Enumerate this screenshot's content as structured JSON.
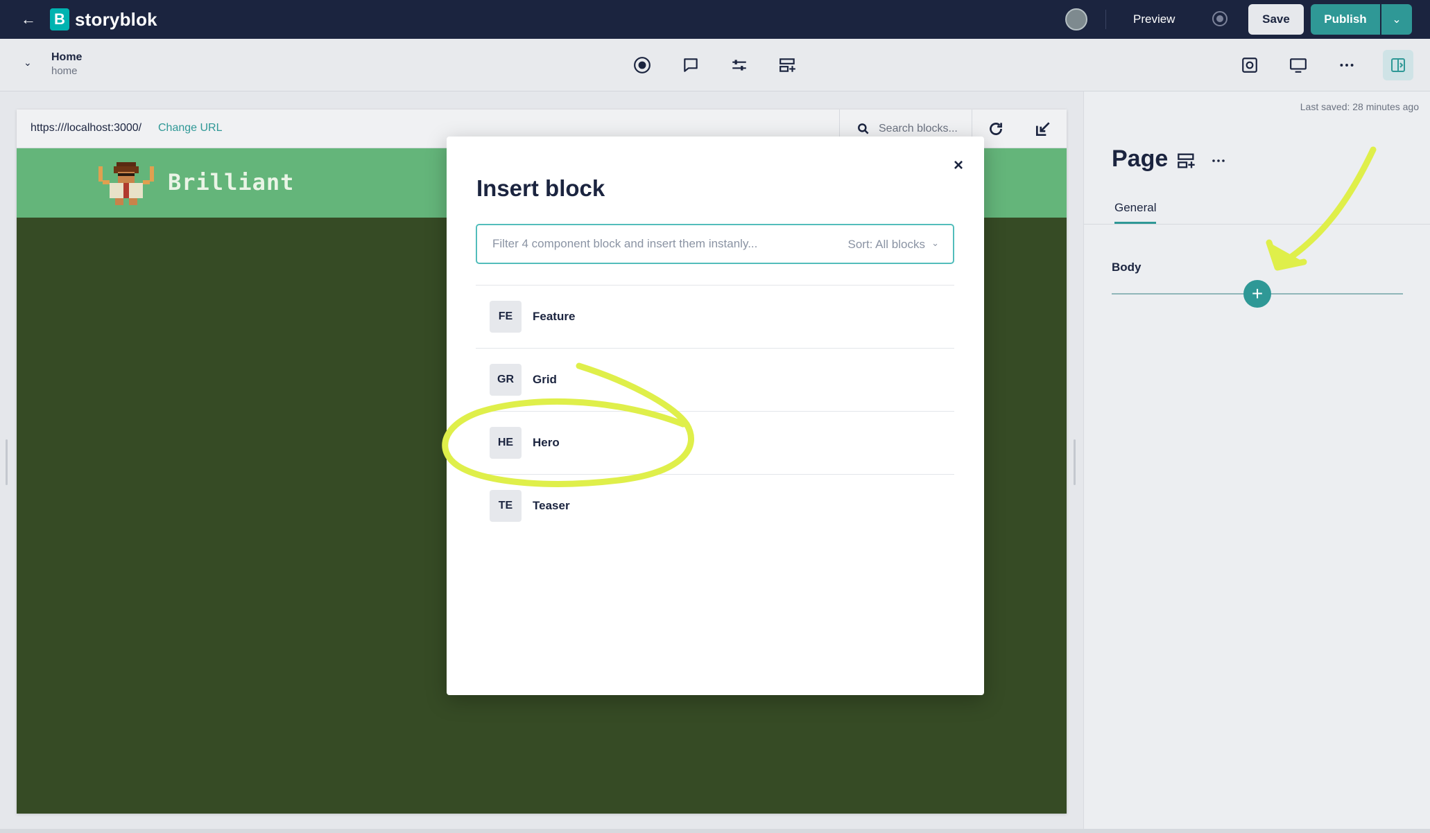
{
  "app": {
    "brand": "storyblok",
    "logo_letter": "B",
    "preview_label": "Preview",
    "save_label": "Save",
    "publish_label": "Publish",
    "colors": {
      "topbar": "#1b243f",
      "accent": "#2f9896",
      "highlight": "#dfef4a"
    }
  },
  "story": {
    "title": "Home",
    "slug": "home"
  },
  "toolbar": {
    "icons": [
      "record-icon",
      "comment-icon",
      "sliders-icon",
      "insert-block-icon"
    ],
    "right_icons": [
      "screenshot-icon",
      "desktop-icon",
      "more-icon",
      "panel-toggle-icon"
    ]
  },
  "preview": {
    "url": "https:///localhost:3000/",
    "change_url_label": "Change URL",
    "search_placeholder": "Search blocks...",
    "site_name": "Brilliant",
    "colors": {
      "header": "#64b57a",
      "body": "#364b25"
    }
  },
  "right_panel": {
    "last_saved": "Last saved: 28 minutes ago",
    "page_title": "Page",
    "tab_general": "General",
    "body_label": "Body",
    "add_symbol": "+"
  },
  "modal": {
    "title": "Insert block",
    "close_symbol": "×",
    "filter_placeholder": "Filter 4 component block and insert them instanly...",
    "sort_label": "Sort: All blocks",
    "blocks": [
      {
        "badge": "FE",
        "name": "Feature"
      },
      {
        "badge": "GR",
        "name": "Grid"
      },
      {
        "badge": "HE",
        "name": "Hero"
      },
      {
        "badge": "TE",
        "name": "Teaser"
      }
    ]
  }
}
